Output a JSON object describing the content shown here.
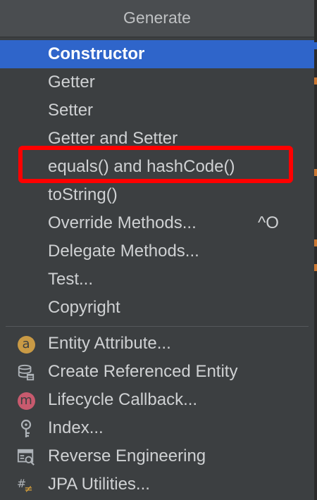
{
  "popup": {
    "title": "Generate"
  },
  "items": [
    {
      "label": "Constructor"
    },
    {
      "label": "Getter"
    },
    {
      "label": "Setter"
    },
    {
      "label": "Getter and Setter"
    },
    {
      "label": "equals() and hashCode()"
    },
    {
      "label": "toString()"
    },
    {
      "label": "Override Methods...",
      "shortcut": "^O"
    },
    {
      "label": "Delegate Methods..."
    },
    {
      "label": "Test..."
    },
    {
      "label": "Copyright"
    }
  ],
  "jpa_items": [
    {
      "label": "Entity Attribute...",
      "icon": "entity-attribute-icon",
      "icon_letter": "a"
    },
    {
      "label": "Create Referenced Entity",
      "icon": "database-entity-icon"
    },
    {
      "label": "Lifecycle Callback...",
      "icon": "lifecycle-callback-icon",
      "icon_letter": "m"
    },
    {
      "label": "Index...",
      "icon": "key-index-icon"
    },
    {
      "label": "Reverse Engineering",
      "icon": "reverse-engineering-icon"
    },
    {
      "label": "JPA Utilities...",
      "icon": "jpa-utilities-icon",
      "icon_text": "#≠"
    }
  ],
  "colors": {
    "selected_background": "#2f65ca",
    "highlight_border": "#ff0000",
    "popup_background": "#3c3f41"
  }
}
